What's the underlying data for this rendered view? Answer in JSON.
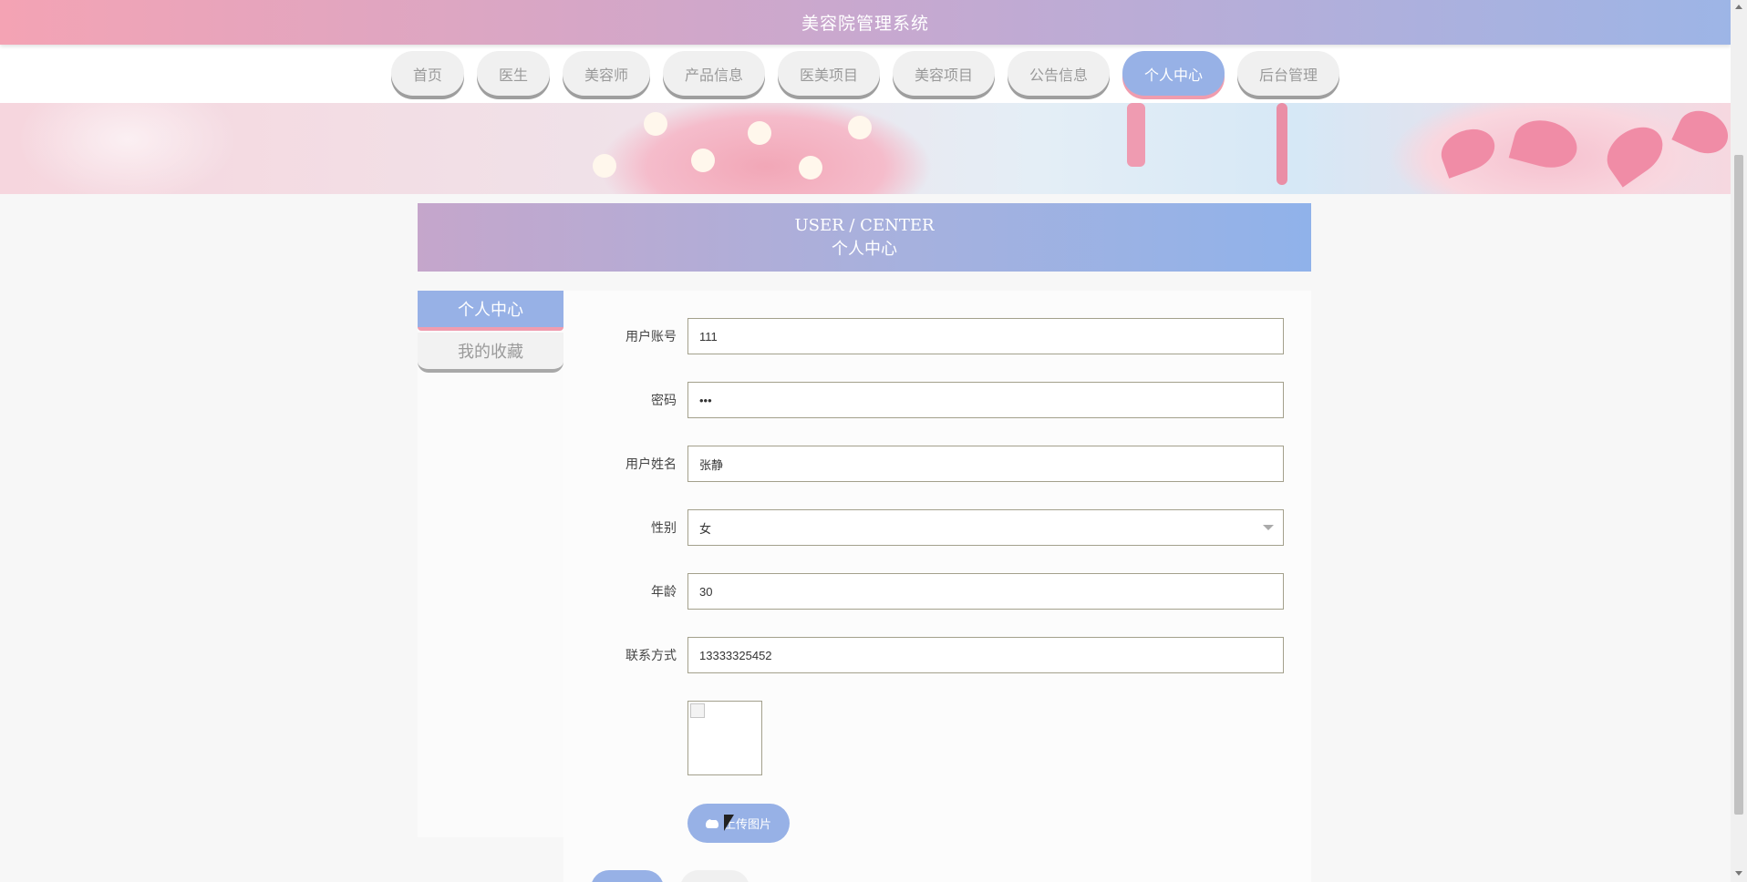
{
  "header": {
    "title": "美容院管理系统"
  },
  "nav": {
    "items": [
      {
        "label": "首页",
        "active": false
      },
      {
        "label": "医生",
        "active": false
      },
      {
        "label": "美容师",
        "active": false
      },
      {
        "label": "产品信息",
        "active": false
      },
      {
        "label": "医美项目",
        "active": false
      },
      {
        "label": "美容项目",
        "active": false
      },
      {
        "label": "公告信息",
        "active": false
      },
      {
        "label": "个人中心",
        "active": true
      },
      {
        "label": "后台管理",
        "active": false
      }
    ]
  },
  "section": {
    "title_en": "USER / CENTER",
    "title_cn": "个人中心"
  },
  "side_menu": {
    "items": [
      {
        "label": "个人中心",
        "active": true
      },
      {
        "label": "我的收藏",
        "active": false
      }
    ]
  },
  "form": {
    "username_label": "用户账号",
    "username_value": "111",
    "password_label": "密码",
    "password_value": "•••",
    "name_label": "用户姓名",
    "name_value": "张静",
    "gender_label": "性别",
    "gender_value": "女",
    "age_label": "年龄",
    "age_value": "30",
    "phone_label": "联系方式",
    "phone_value": "13333325452",
    "upload_label": "上传图片"
  },
  "colors": {
    "accent_blue": "#97b1e6",
    "accent_pink": "#f09cae",
    "header_gradient_start": "#f4a3b4",
    "header_gradient_end": "#9db5e6"
  }
}
